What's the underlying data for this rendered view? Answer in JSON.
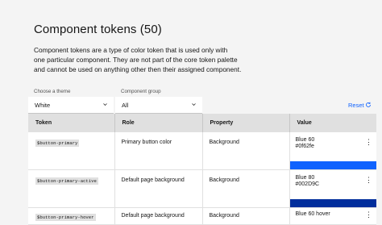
{
  "page": {
    "title": "Component tokens (50)",
    "description_lines": [
      "Component tokens are a type of color token that is used only with",
      "one particular component. They are not part of the core token palette",
      "and cannot be used on anything other then their assigned component."
    ]
  },
  "filters": {
    "theme": {
      "label": "Choose a theme",
      "value": "White"
    },
    "group": {
      "label": "Component group",
      "value": "All"
    },
    "reset_label": "Reset"
  },
  "table": {
    "headers": {
      "token": "Token",
      "role": "Role",
      "property": "Property",
      "value": "Value"
    },
    "rows": [
      {
        "token": "$button-primary",
        "role": "Primary button color",
        "property": "Background",
        "value_name": "Blue 60",
        "value_hex": "#0f62fe",
        "swatch": "#0f62fe"
      },
      {
        "token": "$button-primary-active",
        "role": "Default page background",
        "property": "Background",
        "value_name": "Blue 80",
        "value_hex": "#002D9C",
        "swatch": "#002d9c"
      },
      {
        "token": "$button-primary-hover",
        "role": "Default page background",
        "property": "Background",
        "value_name": "Blue 60 hover"
      }
    ]
  },
  "colors": {
    "accent": "#0f62fe",
    "background": "#f4f4f4",
    "header_bg": "#e0e0e0"
  },
  "icons": {
    "chevron": "chevron-down-icon",
    "reset": "reset-icon",
    "overflow": "overflow-menu-icon"
  }
}
